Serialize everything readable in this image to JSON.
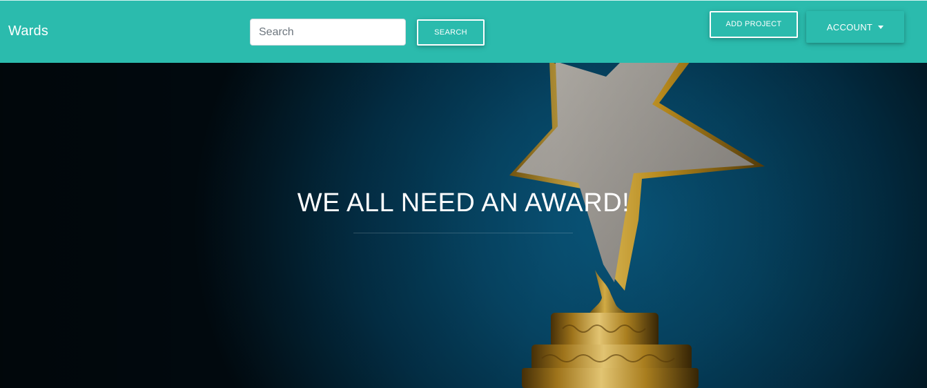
{
  "navbar": {
    "brand": "Wards",
    "search_placeholder": "Search",
    "search_button": "SEARCH",
    "add_project_button": "ADD PROJECT",
    "account_button": "ACCOUNT",
    "background_color": "#2bbbad"
  },
  "hero": {
    "title": "WE ALL NEED AN AWARD!",
    "image": "gold-star-trophy"
  }
}
